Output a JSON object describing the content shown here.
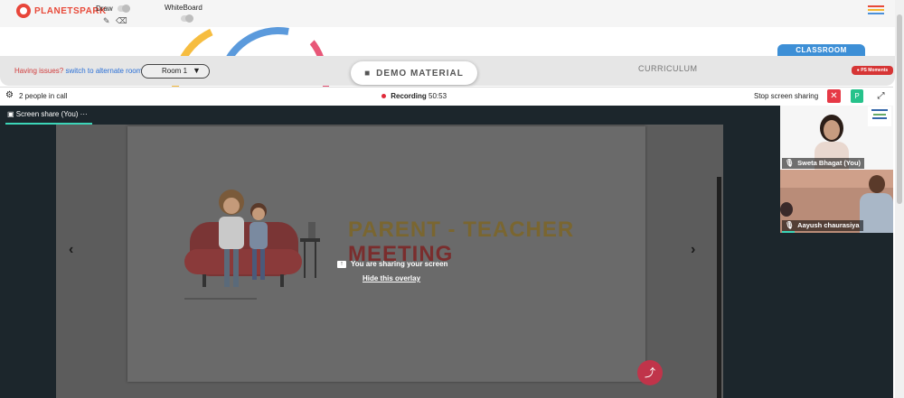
{
  "topbar": {
    "logo_text": "PLANETSPARK",
    "draw_label": "Draw",
    "whiteboard_label": "WhiteBoard",
    "hamburger_colors": [
      "#e84a3a",
      "#f6b62c",
      "#4a90d9"
    ]
  },
  "roombar": {
    "issues_text": "Having issues?",
    "alternate_link": "switch to alternate room",
    "room_selected": "Room 1",
    "demo_material_label": "DEMO MATERIAL",
    "curriculum_label": "CURRICULUM",
    "classroom_tab": "CLASSROOM",
    "ps_moments": "PS Moments"
  },
  "callbar": {
    "people_count_text": "2 people in call",
    "recording_label": "Recording",
    "recording_time": "50:53",
    "stop_sharing_label": "Stop screen sharing",
    "participant_initial": "P"
  },
  "share": {
    "tab_label": "Screen share (You)",
    "tab_more": "···",
    "slide_title_line1": "PARENT - TEACHER",
    "slide_title_line2": "MEETING",
    "sharing_message": "You are sharing your screen",
    "hide_overlay": "Hide this overlay"
  },
  "participants": [
    {
      "name": "Sweta Bhagat (You)"
    },
    {
      "name": "Aayush chaurasiya"
    }
  ],
  "colors": {
    "accent_teal": "#3cd5b8",
    "record_red": "#e02a3a",
    "classroom_blue": "#3d8fd6",
    "stop_red": "#e63946",
    "participant_green": "#26c28b"
  }
}
